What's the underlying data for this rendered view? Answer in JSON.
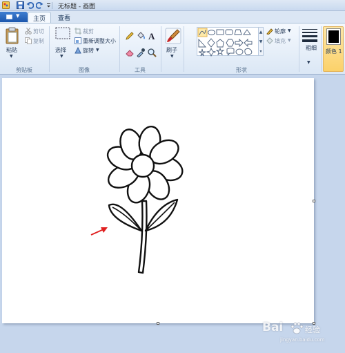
{
  "titlebar": {
    "title": "无标题 - 画图"
  },
  "tabs": {
    "home": "主页",
    "view": "查看"
  },
  "clipboard": {
    "paste": "粘贴",
    "cut": "剪切",
    "copy": "复制",
    "group": "剪贴板"
  },
  "image": {
    "select": "选择",
    "crop": "裁剪",
    "resize": "重新调整大小",
    "rotate": "旋转",
    "group": "图像"
  },
  "tools": {
    "group": "工具"
  },
  "brushes": {
    "label": "刷子"
  },
  "shapes": {
    "outline": "轮廓",
    "fill": "填充",
    "group": "形状"
  },
  "size": {
    "label": "粗细"
  },
  "color1": {
    "label": "颜色 1",
    "value": "#000000"
  },
  "watermark": {
    "brand": "Bai",
    "suffix": "经验",
    "url": "jingyan.baidu.com"
  },
  "colors": {
    "accent": "#1c57ad",
    "arrow": "#e02020",
    "canvas": "#ffffff",
    "workarea": "#c6d6ec"
  }
}
